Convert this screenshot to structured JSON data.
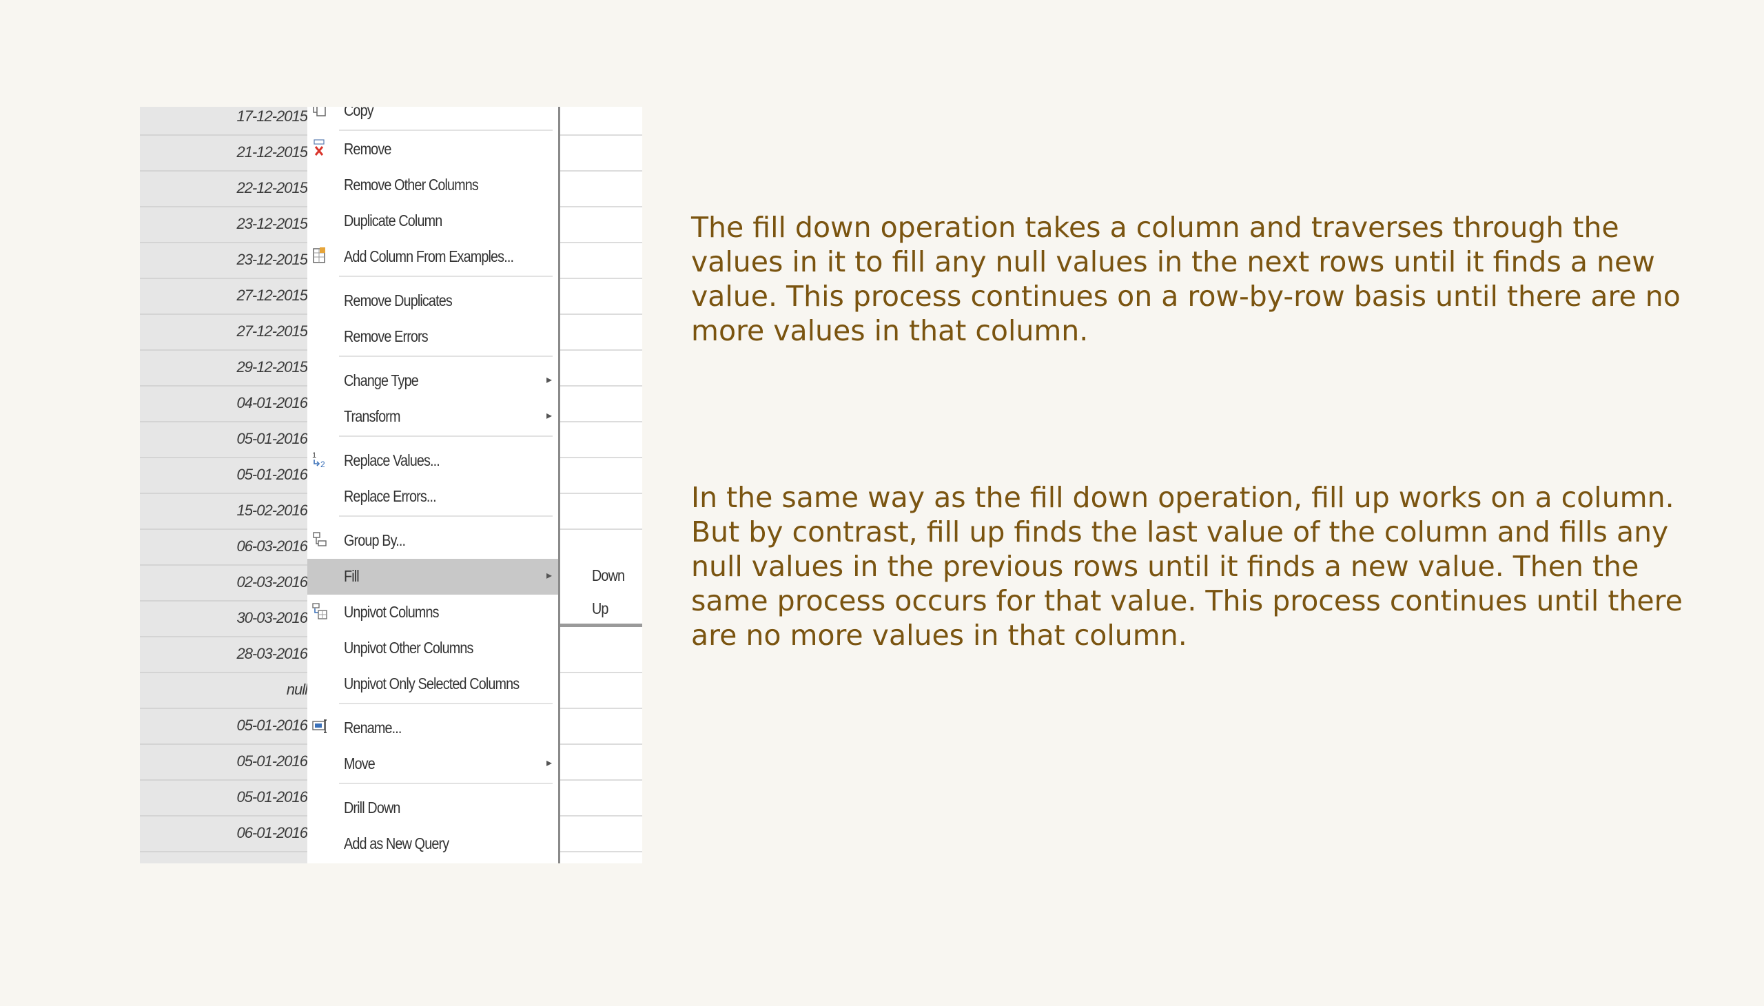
{
  "grid": {
    "dates": [
      "17-12-2015",
      "21-12-2015",
      "22-12-2015",
      "23-12-2015",
      "23-12-2015",
      "27-12-2015",
      "27-12-2015",
      "29-12-2015",
      "04-01-2016",
      "05-01-2016",
      "05-01-2016",
      "15-02-2016",
      "06-03-2016",
      "02-03-2016",
      "30-03-2016",
      "28-03-2016",
      "null",
      "05-01-2016",
      "05-01-2016",
      "05-01-2016",
      "06-01-2016"
    ]
  },
  "context_menu": {
    "items": [
      {
        "label": "Copy",
        "icon": "copy-icon"
      },
      {
        "label": "Remove",
        "icon": "remove-x-icon"
      },
      {
        "label": "Remove Other Columns"
      },
      {
        "label": "Duplicate Column"
      },
      {
        "label": "Add Column From Examples...",
        "icon": "add-column-icon"
      },
      {
        "label": "Remove Duplicates"
      },
      {
        "label": "Remove Errors"
      },
      {
        "label": "Change Type",
        "submenu": true
      },
      {
        "label": "Transform",
        "submenu": true
      },
      {
        "label": "Replace Values...",
        "icon": "replace-values-icon"
      },
      {
        "label": "Replace Errors..."
      },
      {
        "label": "Group By...",
        "icon": "group-by-icon"
      },
      {
        "label": "Fill",
        "submenu": true,
        "active": true
      },
      {
        "label": "Unpivot Columns",
        "icon": "unpivot-icon"
      },
      {
        "label": "Unpivot Other Columns"
      },
      {
        "label": "Unpivot Only Selected Columns"
      },
      {
        "label": "Rename...",
        "icon": "rename-icon"
      },
      {
        "label": "Move",
        "submenu": true
      },
      {
        "label": "Drill Down"
      },
      {
        "label": "Add as New Query"
      }
    ],
    "submenu_fill": [
      "Down",
      "Up"
    ]
  },
  "text": {
    "fill_down": "The fill down operation takes a column and traverses through the values in it to fill any null values in the next rows until it finds a new value. This process continues on a row-by-row basis until there are no more values in that column.",
    "fill_up": "In the same way as the fill down operation, fill up works on a column. But by contrast, fill up finds the last value of the column and fills any null values in the previous rows until it finds a new value. Then the same process occurs for that value. This process continues until there are no more values in that column."
  },
  "colors": {
    "text": "#7a5410",
    "background": "#f8f6f1",
    "menu_highlight": "#c8c8c8"
  }
}
